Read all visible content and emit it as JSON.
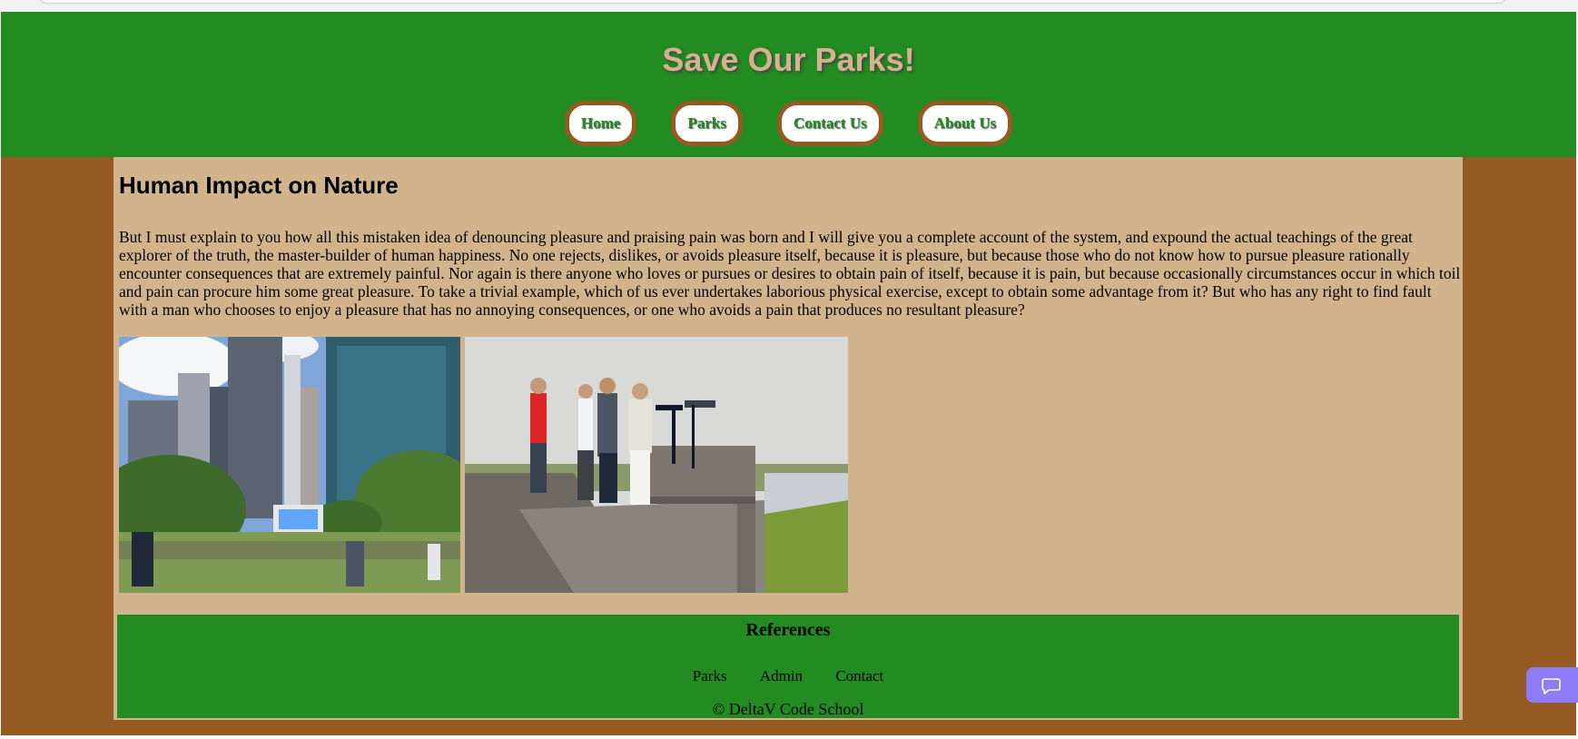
{
  "header": {
    "title": "Save Our Parks!",
    "nav": [
      {
        "label": "Home"
      },
      {
        "label": "Parks"
      },
      {
        "label": "Contact Us"
      },
      {
        "label": "About Us"
      }
    ]
  },
  "article": {
    "heading": "Human Impact on Nature",
    "body": "But I must explain to you how all this mistaken idea of denouncing pleasure and praising pain was born and I will give you a complete account of the system, and expound the actual teachings of the great explorer of the truth, the master-builder of human happiness. No one rejects, dislikes, or avoids pleasure itself, because it is pleasure, but because those who do not know how to pursue pleasure rationally encounter consequences that are extremely painful. Nor again is there anyone who loves or pursues or desires to obtain pain of itself, because it is pain, but because occasionally circumstances occur in which toil and pain can procure him some great pleasure. To take a trivial example, which of us ever undertakes laborious physical exercise, except to obtain some advantage from it? But who has any right to find fault with a man who chooses to enjoy a pleasure that has no annoying consequences, or one who avoids a pain that produces no resultant pleasure?"
  },
  "footer": {
    "title": "References",
    "links": [
      {
        "label": "Parks"
      },
      {
        "label": "Admin"
      },
      {
        "label": "Contact"
      }
    ],
    "copyright": "© DeltaV Code School"
  },
  "colors": {
    "header_green": "#228b22",
    "brown": "#955a22",
    "tan": "#d2b48c",
    "chat_purple": "#8f7cf8"
  },
  "icons": {
    "chat": "chat-icon"
  }
}
